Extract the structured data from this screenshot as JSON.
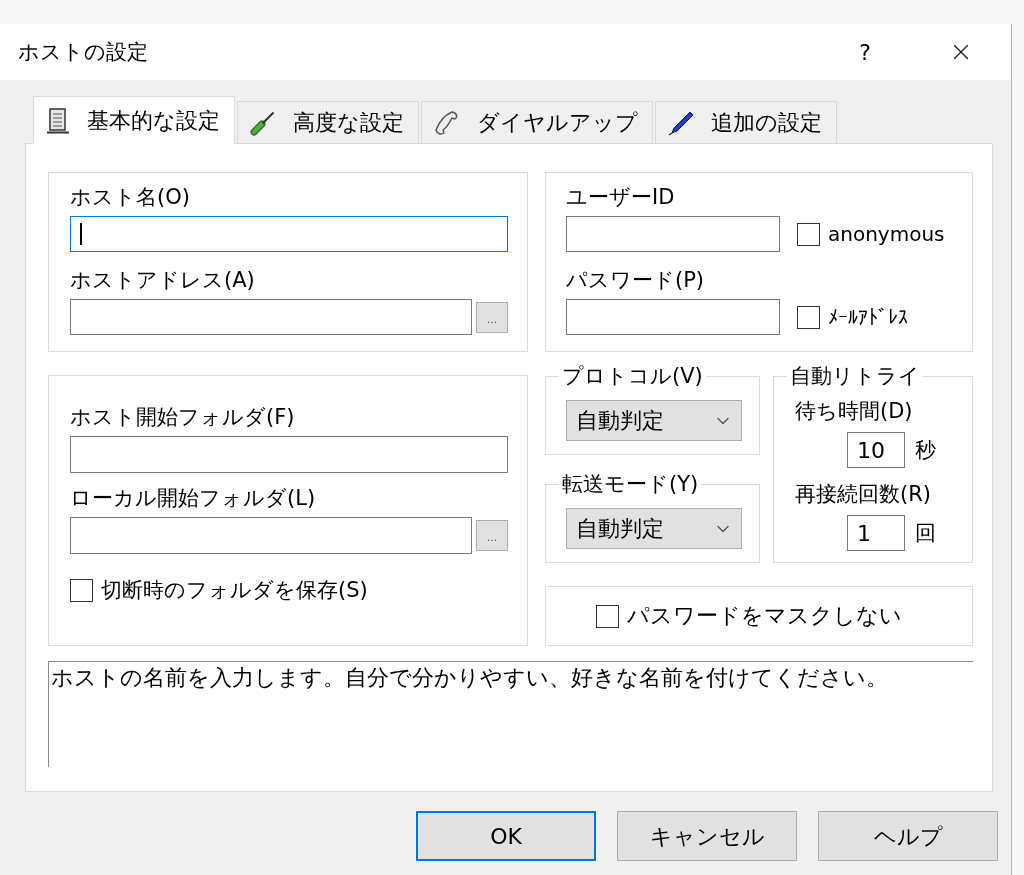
{
  "window": {
    "title": "ホストの設定",
    "help_button": "?"
  },
  "tabs": [
    {
      "label": "基本的な設定",
      "selected": true
    },
    {
      "label": "高度な設定",
      "selected": false
    },
    {
      "label": "ダイヤルアップ",
      "selected": false
    },
    {
      "label": "追加の設定",
      "selected": false
    }
  ],
  "host_group": {
    "fields": [
      {
        "label": "ホスト名(O)",
        "focused": true
      },
      {
        "label": "ホストアドレス(A)",
        "focused": false,
        "browse_button": "..."
      }
    ]
  },
  "account_group": {
    "fields": [
      {
        "label": "ユーザーID",
        "focused": false,
        "checkbox": {
          "label": "anonymous",
          "checked": false
        }
      },
      {
        "label": "パスワード(P)",
        "focused": false,
        "checkbox": {
          "label": "ﾒｰﾙｱﾄﾞﾚｽ",
          "checked": false
        }
      }
    ]
  },
  "folder_group": {
    "fields": [
      {
        "label": "ホスト開始フォルダ(F)",
        "focused": false
      },
      {
        "label": "ローカル開始フォルダ(L)",
        "focused": false,
        "browse_button": "..."
      }
    ],
    "checkbox": {
      "label": "切断時のフォルダを保存(S)",
      "checked": false
    }
  },
  "protocol": {
    "title": "プロトコル(V)",
    "value": "自動判定"
  },
  "transfer_mode": {
    "title": "転送モード(Y)",
    "value": "自動判定"
  },
  "auto_retry": {
    "title": "自動リトライ",
    "fields": [
      {
        "label": "待ち時間(D)",
        "value": "10",
        "unit": "秒"
      },
      {
        "label": "再接続回数(R)",
        "value": "1",
        "unit": "回"
      }
    ]
  },
  "mask_password": {
    "label": "パスワードをマスクしない",
    "checked": false
  },
  "description": "ホストの名前を入力します。自分で分かりやすい、好きな名前を付けてください。",
  "buttons": [
    {
      "label": "OK",
      "default": true
    },
    {
      "label": "キャンセル",
      "default": false
    },
    {
      "label": "ヘルプ",
      "default": false
    }
  ]
}
